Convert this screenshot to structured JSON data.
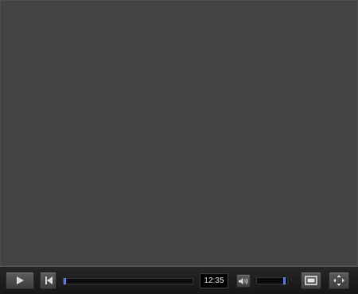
{
  "player": {
    "time": "12:35",
    "progress_fraction": 0.0,
    "volume_fraction": 0.95
  },
  "icons": {
    "play": "play-icon",
    "restart": "skip-back-icon",
    "volume": "speaker-icon",
    "screen": "screen-size-icon",
    "fullscreen": "fullscreen-arrows-icon"
  },
  "colors": {
    "video_bg": "#434343",
    "controls_bg": "#1e1e1e",
    "handle": "#2e58d6"
  }
}
